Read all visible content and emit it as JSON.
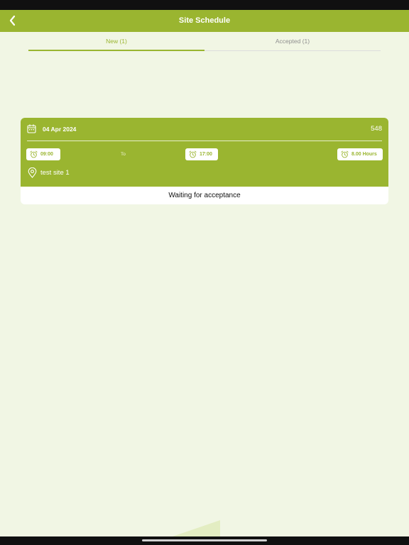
{
  "header": {
    "title": "Site Schedule",
    "back_icon": "chevron-left-icon"
  },
  "tabs": [
    {
      "label": "New (1)",
      "active": true
    },
    {
      "label": "Accepted (1)",
      "active": false
    }
  ],
  "schedule_card": {
    "date": "04 Apr 2024",
    "id": "548",
    "start_time": "09:00",
    "separator": "To",
    "end_time": "17:00",
    "hours": "8.00 Hours",
    "site": "test site 1",
    "status": "Waiting for acceptance"
  },
  "colors": {
    "accent": "#9ab530",
    "background": "#f1f6e4"
  }
}
